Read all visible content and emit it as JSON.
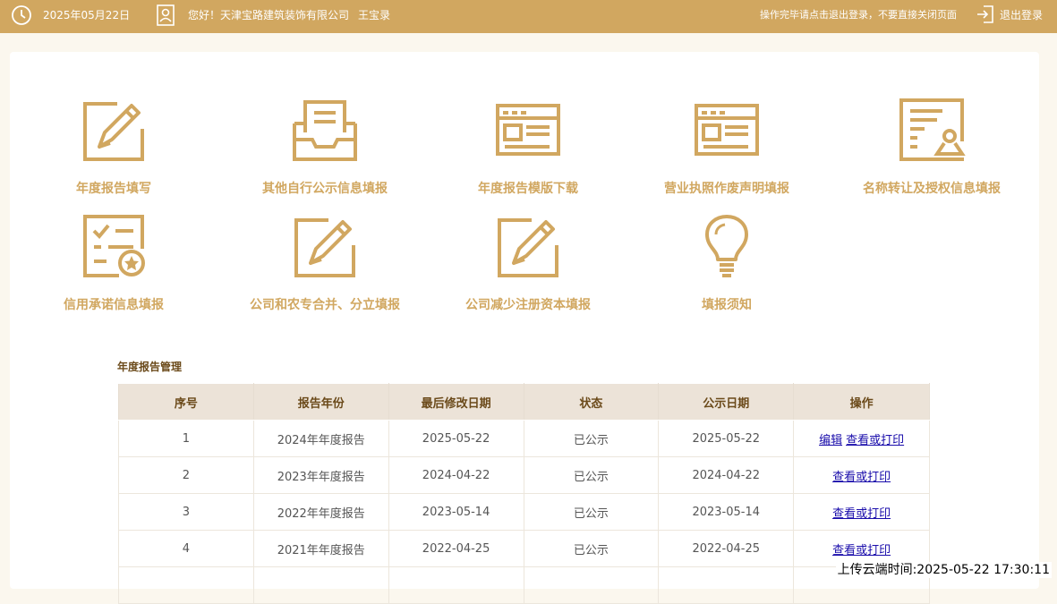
{
  "header": {
    "date": "2025年05月22日",
    "greeting": "您好！天津宝路建筑装饰有限公司",
    "user_name": "王宝录",
    "notice": "操作完毕请点击退出登录，不要直接关闭页面",
    "logout_label": "退出登录"
  },
  "menu": [
    {
      "label": "年度报告填写",
      "icon": "pencil-edit-icon"
    },
    {
      "label": "其他自行公示信息填报",
      "icon": "inbox-tray-icon"
    },
    {
      "label": "年度报告模版下载",
      "icon": "template-window-icon"
    },
    {
      "label": "营业执照作废声明填报",
      "icon": "template-window-icon"
    },
    {
      "label": "名称转让及授权信息填报",
      "icon": "document-stamp-icon"
    },
    {
      "label": "信用承诺信息填报",
      "icon": "checklist-badge-icon"
    },
    {
      "label": "公司和农专合并、分立填报",
      "icon": "pencil-edit-icon"
    },
    {
      "label": "公司减少注册资本填报",
      "icon": "pencil-edit-icon"
    },
    {
      "label": "填报须知",
      "icon": "lightbulb-icon"
    }
  ],
  "reports": {
    "title": "年度报告管理",
    "columns": [
      "序号",
      "报告年份",
      "最后修改日期",
      "状态",
      "公示日期",
      "操作"
    ],
    "rows": [
      {
        "index": "1",
        "year": "2024年年度报告",
        "modified": "2025-05-22",
        "status": "已公示",
        "published": "2025-05-22",
        "actions": [
          "编辑",
          "查看或打印"
        ]
      },
      {
        "index": "2",
        "year": "2023年年度报告",
        "modified": "2024-04-22",
        "status": "已公示",
        "published": "2024-04-22",
        "actions": [
          "查看或打印"
        ]
      },
      {
        "index": "3",
        "year": "2022年年度报告",
        "modified": "2023-05-14",
        "status": "已公示",
        "published": "2023-05-14",
        "actions": [
          "查看或打印"
        ]
      },
      {
        "index": "4",
        "year": "2021年年度报告",
        "modified": "2022-04-25",
        "status": "已公示",
        "published": "2022-04-25",
        "actions": [
          "查看或打印"
        ]
      }
    ]
  },
  "footer": {
    "upload_time": "上传云端时间:2025-05-22 17:30:11"
  },
  "colors": {
    "header_bg": "#d1a760",
    "accent": "#d1a760",
    "table_header_bg": "#ece3d8",
    "link": "#1a0dab"
  }
}
